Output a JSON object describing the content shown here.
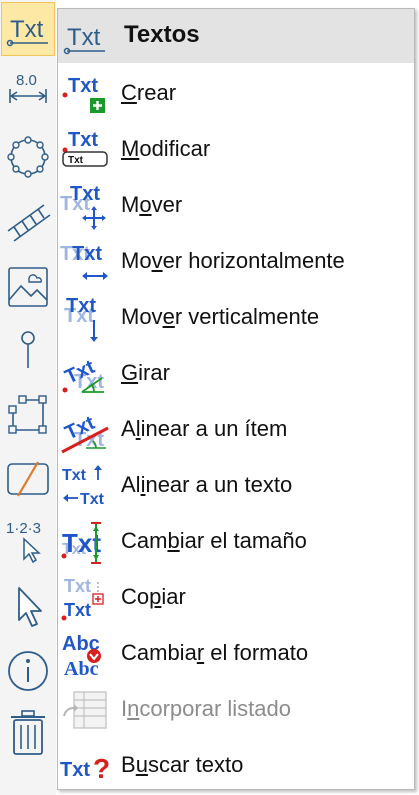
{
  "toolbar": {
    "tools": [
      {
        "name": "texts-tool-icon",
        "label": "Txt"
      },
      {
        "name": "dimension-tool-icon",
        "label": "8.0"
      },
      {
        "name": "circle-symbol-tool-icon"
      },
      {
        "name": "ladder-tool-icon"
      },
      {
        "name": "image-tool-icon"
      },
      {
        "name": "pin-tool-icon"
      },
      {
        "name": "polygon-tool-icon"
      },
      {
        "name": "slash-frame-tool-icon"
      },
      {
        "name": "numbering-tool-icon",
        "label": "1·2·3"
      },
      {
        "name": "select-arrow-tool-icon"
      },
      {
        "name": "info-tool-icon"
      },
      {
        "name": "trash-tool-icon"
      }
    ]
  },
  "menu": {
    "title": "Textos",
    "items": [
      {
        "pre": "",
        "u": "C",
        "post": "rear",
        "disabled": false,
        "icon": "create-text-icon"
      },
      {
        "pre": "",
        "u": "M",
        "post": "odificar",
        "disabled": false,
        "icon": "modify-text-icon"
      },
      {
        "pre": "M",
        "u": "o",
        "post": "ver",
        "disabled": false,
        "icon": "move-text-icon"
      },
      {
        "pre": "Mo",
        "u": "v",
        "post": "er horizontalmente",
        "disabled": false,
        "icon": "move-horizontal-icon"
      },
      {
        "pre": "Mov",
        "u": "e",
        "post": "r verticalmente",
        "disabled": false,
        "icon": "move-vertical-icon"
      },
      {
        "pre": "",
        "u": "G",
        "post": "irar",
        "disabled": false,
        "icon": "rotate-text-icon"
      },
      {
        "pre": "A",
        "u": "l",
        "post": "inear a un ítem",
        "disabled": false,
        "icon": "align-item-icon"
      },
      {
        "pre": "Al",
        "u": "i",
        "post": "near a un texto",
        "disabled": false,
        "icon": "align-text-icon"
      },
      {
        "pre": "Cam",
        "u": "b",
        "post": "iar el tamaño",
        "disabled": false,
        "icon": "resize-text-icon"
      },
      {
        "pre": "Co",
        "u": "p",
        "post": "iar",
        "disabled": false,
        "icon": "copy-text-icon"
      },
      {
        "pre": "Cambia",
        "u": "r",
        "post": " el formato",
        "disabled": false,
        "icon": "change-format-icon"
      },
      {
        "pre": "I",
        "u": "n",
        "post": "corporar listado",
        "disabled": true,
        "icon": "import-list-icon"
      },
      {
        "pre": "B",
        "u": "u",
        "post": "scar texto",
        "disabled": false,
        "icon": "search-text-icon"
      }
    ]
  },
  "colors": {
    "accent": "#1f57c8",
    "tool_stroke": "#2f5d89",
    "green": "#1a9a2a",
    "red": "#d62020"
  }
}
